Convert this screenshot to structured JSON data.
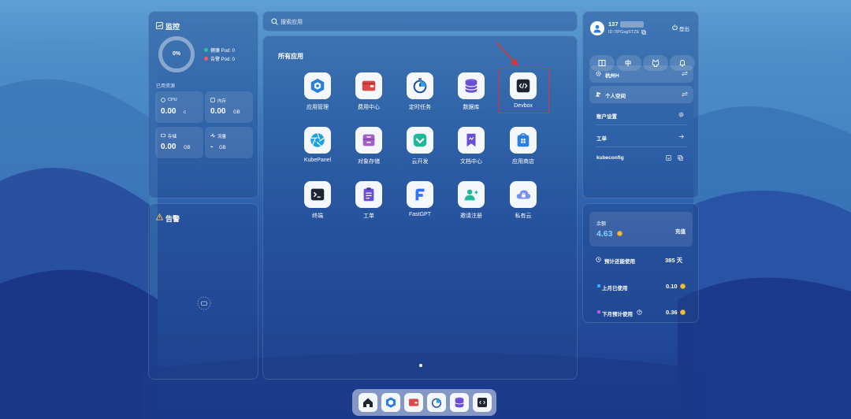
{
  "monitor": {
    "title": "监控",
    "percent": "0%",
    "healthy_pod": "健康 Pod: 0",
    "alert_pod": "告警 Pod: 0",
    "resources_label": "已用资源",
    "cpu": {
      "label": "CPU",
      "value": "0.00",
      "unit": "c"
    },
    "memory": {
      "label": "内存",
      "value": "0.00",
      "unit": "GB"
    },
    "storage": {
      "label": "存储",
      "value": "0.00",
      "unit": "GB"
    },
    "traffic": {
      "label": "流量",
      "value": "-",
      "unit": "GB"
    }
  },
  "alerts": {
    "title": "告警"
  },
  "search": {
    "placeholder": "搜索应用"
  },
  "apps": {
    "title": "所有应用",
    "items": [
      {
        "label": "应用管理",
        "icon": "hexagon-icon"
      },
      {
        "label": "费用中心",
        "icon": "wallet-icon"
      },
      {
        "label": "定时任务",
        "icon": "timer-icon"
      },
      {
        "label": "数据库",
        "icon": "database-icon"
      },
      {
        "label": "Devbox",
        "icon": "code-icon"
      },
      {
        "label": "KubePanel",
        "icon": "aperture-icon"
      },
      {
        "label": "对象存储",
        "icon": "storage-icon"
      },
      {
        "label": "云开发",
        "icon": "cloud-dev-icon"
      },
      {
        "label": "文档中心",
        "icon": "docs-icon"
      },
      {
        "label": "应用商店",
        "icon": "app-store-icon"
      },
      {
        "label": "终端",
        "icon": "terminal-icon"
      },
      {
        "label": "工单",
        "icon": "ticket-icon"
      },
      {
        "label": "FastGPT",
        "icon": "fastgpt-icon"
      },
      {
        "label": "邀请注册",
        "icon": "invite-icon"
      },
      {
        "label": "私有云",
        "icon": "private-cloud-icon"
      }
    ]
  },
  "user": {
    "phone": "137",
    "id": "ID:7lPGsgSTZE",
    "logout": "登出",
    "lang": "中"
  },
  "workspace": {
    "region": "杭州H",
    "space": "个人空间",
    "account_settings": "账户设置",
    "ticket": "工单",
    "kubeconfig": "kubeconfig"
  },
  "billing": {
    "balance_label": "余额",
    "balance": "4.63",
    "recharge": "充值",
    "days_label": "预计还能使用",
    "days": "385 天",
    "last_month_label": "上月已使用",
    "last_month": "0.10",
    "next_month_label": "下月预计使用",
    "next_month": "0.36"
  },
  "colors": {
    "accent_red": "#e0342c",
    "healthy": "#27c499",
    "alert": "#f0577a",
    "balance": "#7fd3ff"
  }
}
